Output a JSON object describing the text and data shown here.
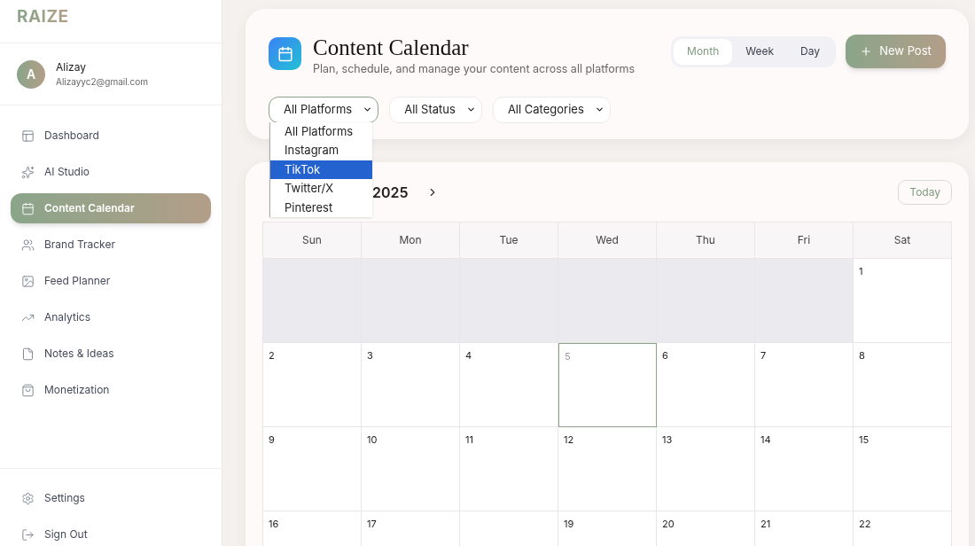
{
  "sidebar": {
    "logo": "RAIZE",
    "user": {
      "initial": "A",
      "name": "Alizay",
      "email": "Alizayyc2@gmail.com"
    },
    "items": [
      {
        "label": "Dashboard",
        "selected": false
      },
      {
        "label": "AI Studio",
        "selected": false
      },
      {
        "label": "Content Calendar",
        "selected": true
      },
      {
        "label": "Brand Tracker",
        "selected": false
      },
      {
        "label": "Feed Planner",
        "selected": false
      },
      {
        "label": "Analytics",
        "selected": false
      },
      {
        "label": "Notes & Ideas",
        "selected": false
      },
      {
        "label": "Monetization",
        "selected": false
      }
    ],
    "footer_items": [
      {
        "label": "Settings"
      },
      {
        "label": "Sign Out"
      }
    ]
  },
  "header": {
    "title": "Content Calendar",
    "subtitle": "Plan, schedule, and manage your content across all platforms",
    "views": [
      {
        "label": "Month",
        "selected": true
      },
      {
        "label": "Week",
        "selected": false
      },
      {
        "label": "Day",
        "selected": false
      }
    ],
    "new_post": "New Post",
    "filters": [
      {
        "value": "All Platforms",
        "expanded": true
      },
      {
        "value": "All Status",
        "expanded": false
      },
      {
        "value": "All Categories",
        "expanded": false
      }
    ],
    "platform_options": [
      {
        "label": "All Platforms",
        "selected": false
      },
      {
        "label": "Instagram",
        "selected": false
      },
      {
        "label": "TikTok",
        "selected": true
      },
      {
        "label": "Twitter/X",
        "selected": false
      },
      {
        "label": "Pinterest",
        "selected": false
      }
    ]
  },
  "calendar": {
    "month_label": "2025",
    "today_button": "Today",
    "weekdays": [
      "Sun",
      "Mon",
      "Tue",
      "Wed",
      "Thu",
      "Fri",
      "Sat"
    ],
    "cells": [
      {
        "in_month": false
      },
      {
        "in_month": false
      },
      {
        "in_month": false
      },
      {
        "in_month": false
      },
      {
        "in_month": false
      },
      {
        "in_month": false
      },
      {
        "in_month": true,
        "day": "1",
        "today": false
      },
      {
        "in_month": true,
        "day": "2",
        "today": false
      },
      {
        "in_month": true,
        "day": "3",
        "today": false
      },
      {
        "in_month": true,
        "day": "4",
        "today": false
      },
      {
        "in_month": true,
        "day": "5",
        "today": true
      },
      {
        "in_month": true,
        "day": "6",
        "today": false
      },
      {
        "in_month": true,
        "day": "7",
        "today": false
      },
      {
        "in_month": true,
        "day": "8",
        "today": false
      },
      {
        "in_month": true,
        "day": "9",
        "today": false
      },
      {
        "in_month": true,
        "day": "10",
        "today": false
      },
      {
        "in_month": true,
        "day": "11",
        "today": false
      },
      {
        "in_month": true,
        "day": "12",
        "today": false
      },
      {
        "in_month": true,
        "day": "13",
        "today": false
      },
      {
        "in_month": true,
        "day": "14",
        "today": false
      },
      {
        "in_month": true,
        "day": "15",
        "today": false
      },
      {
        "in_month": true,
        "day": "16",
        "today": false
      },
      {
        "in_month": true,
        "day": "17",
        "today": false
      },
      {
        "in_month": true,
        "today": false
      },
      {
        "in_month": true,
        "day": "19",
        "today": false
      },
      {
        "in_month": true,
        "day": "20",
        "today": false
      },
      {
        "in_month": true,
        "day": "21",
        "today": false
      },
      {
        "in_month": true,
        "day": "22",
        "today": false
      }
    ]
  }
}
